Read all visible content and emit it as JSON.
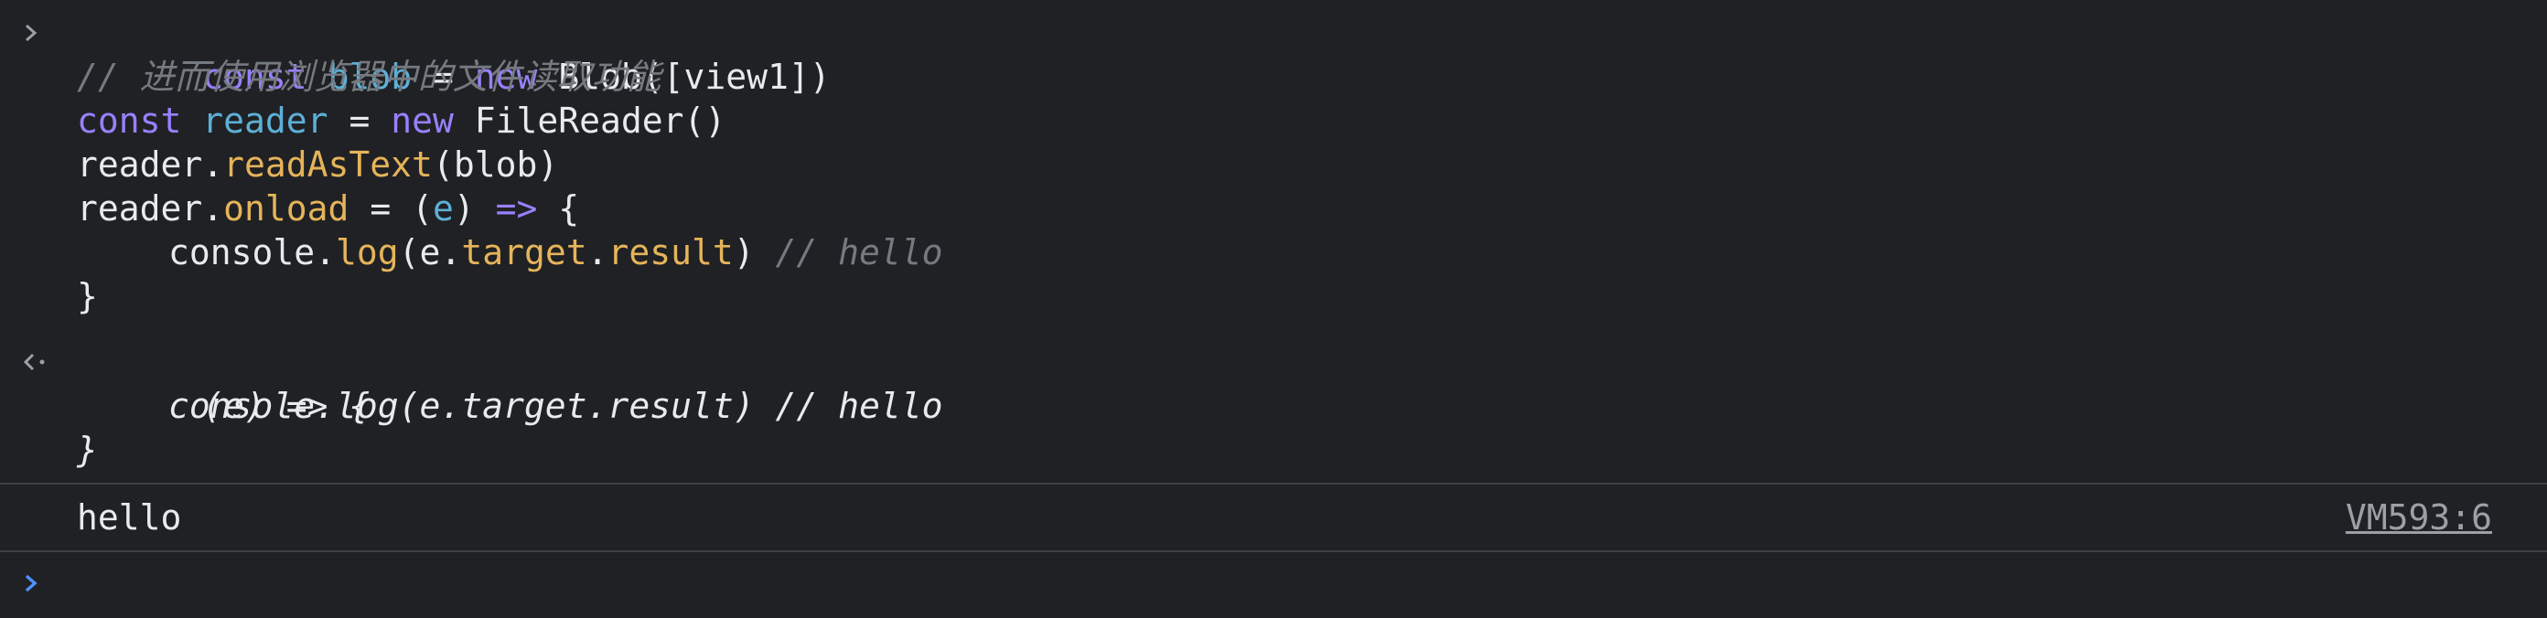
{
  "input_block": {
    "lines": [
      [
        "const",
        " ",
        "blob",
        " = ",
        "new",
        " Blob([view1])"
      ],
      [
        "// 进而使用浏览器中的文件读取功能"
      ],
      [
        "const",
        " ",
        "reader",
        " = ",
        "new",
        " FileReader()"
      ],
      [
        "reader.",
        "readAsText",
        "(blob)"
      ],
      [
        "reader.",
        "onload",
        " = (",
        "e",
        ") ",
        "=>",
        " {"
      ],
      [
        "console.",
        "log",
        "(e.",
        "target",
        ".",
        "result",
        ") ",
        "// hello"
      ],
      [
        "}"
      ]
    ]
  },
  "return_block": {
    "lines": [
      "(e) => {",
      "console.log(e.target.result) // hello",
      "}"
    ]
  },
  "log_entry": {
    "message": "hello",
    "source_link": "VM593:6"
  },
  "icons": {
    "input_prompt": "chevron-right-icon",
    "return_prompt": "return-arrow-icon",
    "active_prompt": "chevron-right-icon"
  },
  "colors": {
    "background": "#202124",
    "keyword": "#9980ff",
    "variable": "#5db0d7",
    "function": "#e5b45a",
    "comment": "#747a80",
    "active_prompt": "#4d90fe"
  }
}
